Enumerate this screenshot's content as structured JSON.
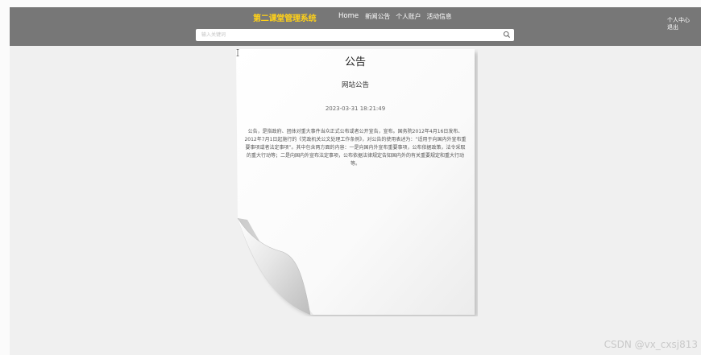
{
  "header": {
    "brand": "第二课堂管理系统",
    "nav": [
      "Home",
      "新闻公告",
      "个人账户",
      "活动信息"
    ],
    "user_links": [
      "个人中心",
      "退出"
    ],
    "search": {
      "placeholder": "输入关键词",
      "value": ""
    }
  },
  "article": {
    "title": "公告",
    "subtitle": "网站公告",
    "date": "2023-03-31 18:21:49",
    "body": "公告，是指政府、团体对重大事件当众正式公布或者公开宣告，宣布。国务院2012年4月16日发布、2012年7月1日起施行的《党政机关公文处理工作条例》，对公告的使用表述为：“适用于向国内外宣布重要事项或者法定事项”。其中包含两方面的内容：一是向国内外宣布重要事项，公布依据政策，法令采取的重大行动等；二是向国内外宣布法定事项，公布依据法律规定告知国内外的有关重要规定和重大行动等。"
  },
  "watermark": "CSDN @vx_cxsj813"
}
